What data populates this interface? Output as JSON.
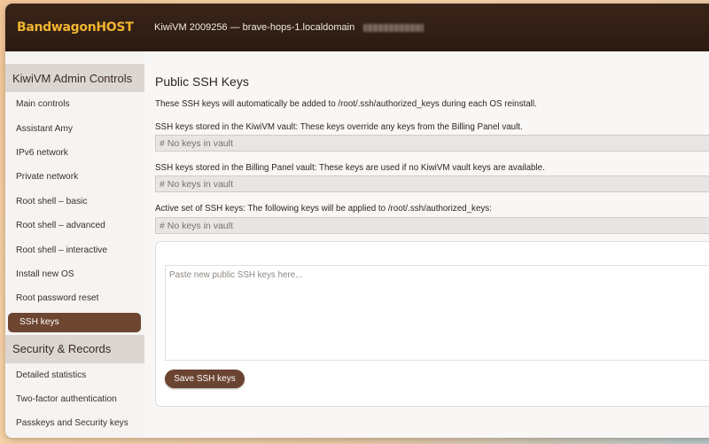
{
  "header": {
    "logo": "BandwagonHOST",
    "title": "KiwiVM 2009256 — brave-hops-1.localdomain"
  },
  "sidebar": {
    "section1": "KiwiVM Admin Controls",
    "items1": [
      {
        "label": "Main controls"
      },
      {
        "label": "Assistant Amy"
      },
      {
        "label": "IPv6 network"
      },
      {
        "label": "Private network"
      },
      {
        "label": "Root shell – basic"
      },
      {
        "label": "Root shell – advanced"
      },
      {
        "label": "Root shell – interactive"
      },
      {
        "label": "Install new OS"
      },
      {
        "label": "Root password reset"
      },
      {
        "label": "SSH keys"
      }
    ],
    "section2": "Security & Records",
    "items2": [
      {
        "label": "Detailed statistics"
      },
      {
        "label": "Two-factor authentication"
      },
      {
        "label": "Passkeys and Security keys"
      }
    ]
  },
  "main": {
    "title": "Public SSH Keys",
    "intro": "These SSH keys will automatically be added to /root/.ssh/authorized_keys during each OS reinstall.",
    "kiwivm_label": "SSH keys stored in the KiwiVM vault: These keys override any keys from the Billing Panel vault.",
    "kiwivm_value": "# No keys in vault",
    "billing_label": "SSH keys stored in the Billing Panel vault: These keys are used if no KiwiVM vault keys are available.",
    "billing_value": "# No keys in vault",
    "active_label": "Active set of SSH keys: The following keys will be applied to /root/.ssh/authorized_keys:",
    "active_value": "# No keys in vault",
    "textarea_placeholder": "Paste new public SSH keys here...",
    "save_label": "Save SSH keys"
  },
  "colors": {
    "accent": "#6b4431",
    "logo": "#f2b430",
    "topbar": "#2b1a11"
  }
}
